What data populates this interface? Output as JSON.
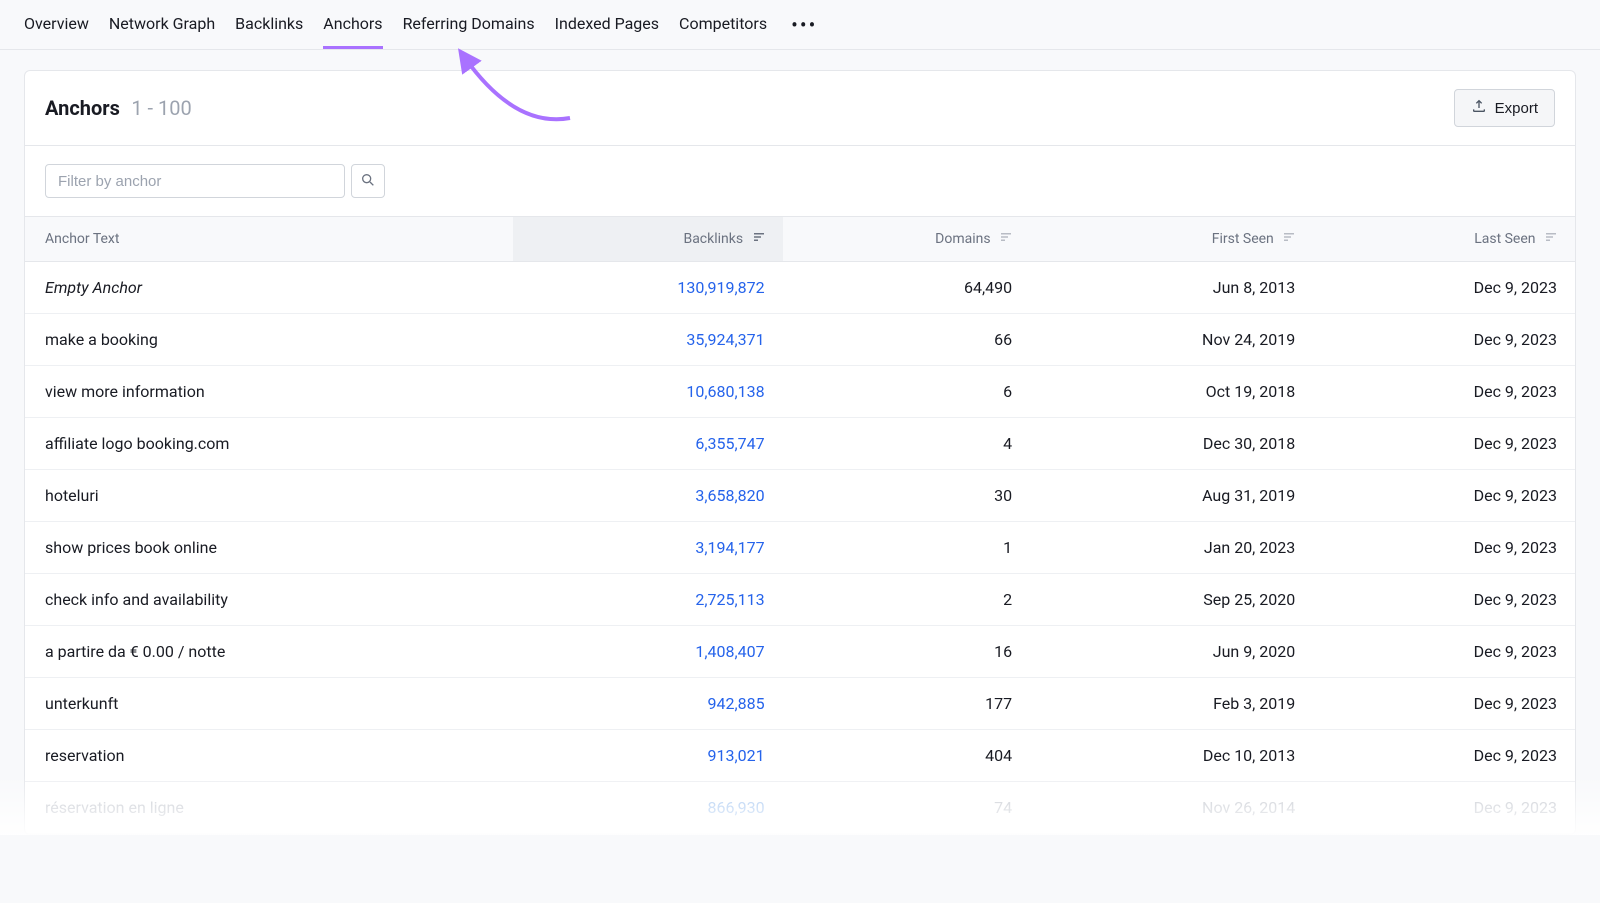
{
  "tabs": {
    "items": [
      "Overview",
      "Network Graph",
      "Backlinks",
      "Anchors",
      "Referring Domains",
      "Indexed Pages",
      "Competitors"
    ],
    "active_index": 3
  },
  "header": {
    "title": "Anchors",
    "range": "1 - 100",
    "export_label": "Export"
  },
  "filter": {
    "placeholder": "Filter by anchor"
  },
  "columns": {
    "anchor": "Anchor Text",
    "backlinks": "Backlinks",
    "domains": "Domains",
    "first_seen": "First Seen",
    "last_seen": "Last Seen"
  },
  "rows": [
    {
      "anchor": "Empty Anchor",
      "backlinks": "130,919,872",
      "domains": "64,490",
      "first_seen": "Jun 8, 2013",
      "last_seen": "Dec 9, 2023",
      "empty": true
    },
    {
      "anchor": "make a booking",
      "backlinks": "35,924,371",
      "domains": "66",
      "first_seen": "Nov 24, 2019",
      "last_seen": "Dec 9, 2023"
    },
    {
      "anchor": "view more information",
      "backlinks": "10,680,138",
      "domains": "6",
      "first_seen": "Oct 19, 2018",
      "last_seen": "Dec 9, 2023"
    },
    {
      "anchor": "affiliate logo booking.com",
      "backlinks": "6,355,747",
      "domains": "4",
      "first_seen": "Dec 30, 2018",
      "last_seen": "Dec 9, 2023"
    },
    {
      "anchor": "hoteluri",
      "backlinks": "3,658,820",
      "domains": "30",
      "first_seen": "Aug 31, 2019",
      "last_seen": "Dec 9, 2023"
    },
    {
      "anchor": "show prices book online",
      "backlinks": "3,194,177",
      "domains": "1",
      "first_seen": "Jan 20, 2023",
      "last_seen": "Dec 9, 2023"
    },
    {
      "anchor": "check info and availability",
      "backlinks": "2,725,113",
      "domains": "2",
      "first_seen": "Sep 25, 2020",
      "last_seen": "Dec 9, 2023"
    },
    {
      "anchor": "a partire da € 0.00 / notte",
      "backlinks": "1,408,407",
      "domains": "16",
      "first_seen": "Jun 9, 2020",
      "last_seen": "Dec 9, 2023"
    },
    {
      "anchor": "unterkunft",
      "backlinks": "942,885",
      "domains": "177",
      "first_seen": "Feb 3, 2019",
      "last_seen": "Dec 9, 2023"
    },
    {
      "anchor": "reservation",
      "backlinks": "913,021",
      "domains": "404",
      "first_seen": "Dec 10, 2013",
      "last_seen": "Dec 9, 2023"
    },
    {
      "anchor": "réservation en ligne",
      "backlinks": "866,930",
      "domains": "74",
      "first_seen": "Nov 26, 2014",
      "last_seen": "Dec 9, 2023",
      "faded": true
    }
  ]
}
